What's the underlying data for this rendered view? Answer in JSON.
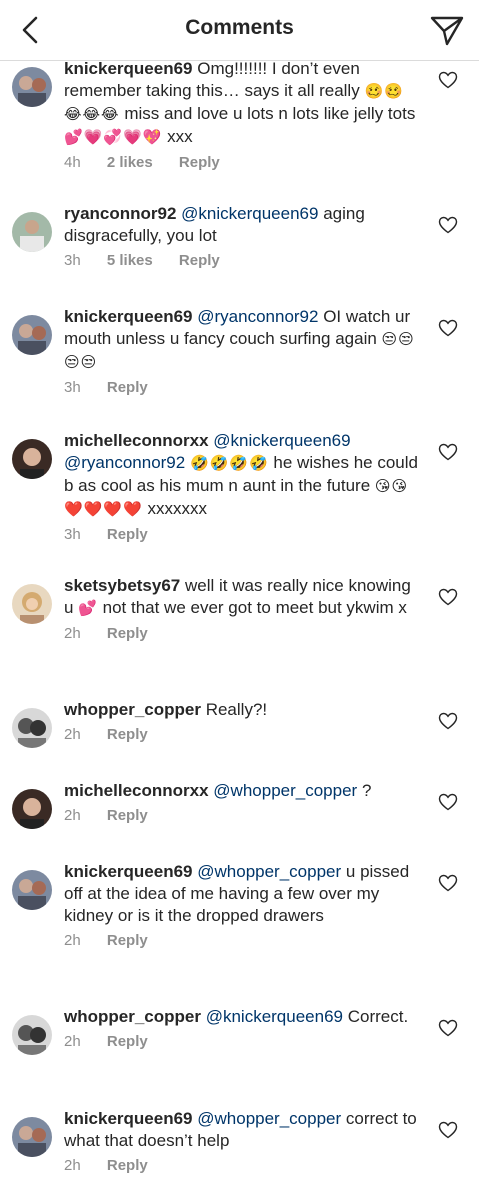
{
  "header": {
    "title": "Comments"
  },
  "comments": [
    {
      "username": "knickerqueen69",
      "mention": "",
      "text": "Omg!!!!!!! I don’t even remember taking this… says it all really",
      "emoji": "🥴🥴😂😂😂",
      "text2": "miss and love u lots n lots like jelly tots",
      "emoji2": "💕💗💞💗💖",
      "text3": "xxx",
      "time": "4h",
      "likes": "2 likes",
      "reply": "Reply"
    },
    {
      "username": "ryanconnor92",
      "mention": "@knickerqueen69",
      "text": "aging disgracefully, you lot",
      "emoji": "",
      "text2": "",
      "emoji2": "",
      "text3": "",
      "time": "3h",
      "likes": "5 likes",
      "reply": "Reply"
    },
    {
      "username": "knickerqueen69",
      "mention": "@ryanconnor92",
      "text": "OI watch ur mouth unless u fancy couch surfing again",
      "emoji": "😒😒😒😒",
      "text2": "",
      "emoji2": "",
      "text3": "",
      "time": "3h",
      "likes": "",
      "reply": "Reply"
    },
    {
      "username": "michelleconnorxx",
      "mention": "@knickerqueen69 @ryanconnor92",
      "text": "",
      "emoji": "🤣🤣🤣🤣",
      "text2": "he wishes he could b as cool as his mum n aunt in the future",
      "emoji2": "😘😘❤️❤️❤️❤️",
      "text3": "xxxxxxx",
      "time": "3h",
      "likes": "",
      "reply": "Reply"
    },
    {
      "username": "sketsybetsy67",
      "mention": "",
      "text": "well it was really nice knowing u",
      "emoji": "💕",
      "text2": "not that we ever got to meet but ykwim x",
      "emoji2": "",
      "text3": "",
      "time": "2h",
      "likes": "",
      "reply": "Reply"
    },
    {
      "username": "whopper_copper",
      "mention": "",
      "text": "Really?!",
      "emoji": "",
      "text2": "",
      "emoji2": "",
      "text3": "",
      "time": "2h",
      "likes": "",
      "reply": "Reply"
    },
    {
      "username": "michelleconnorxx",
      "mention": "@whopper_copper",
      "text": "?",
      "emoji": "",
      "text2": "",
      "emoji2": "",
      "text3": "",
      "time": "2h",
      "likes": "",
      "reply": "Reply"
    },
    {
      "username": "knickerqueen69",
      "mention": "@whopper_copper",
      "text": "u pissed off at the idea of me having a few over my kidney or is it the dropped drawers",
      "emoji": "",
      "text2": "",
      "emoji2": "",
      "text3": "",
      "time": "2h",
      "likes": "",
      "reply": "Reply"
    },
    {
      "username": "whopper_copper",
      "mention": "@knickerqueen69",
      "text": "Correct.",
      "emoji": "",
      "text2": "",
      "emoji2": "",
      "text3": "",
      "time": "2h",
      "likes": "",
      "reply": "Reply"
    },
    {
      "username": "knickerqueen69",
      "mention": "@whopper_copper",
      "text": "correct to what that doesn’t help",
      "emoji": "",
      "text2": "",
      "emoji2": "",
      "text3": "",
      "time": "2h",
      "likes": "",
      "reply": "Reply"
    }
  ],
  "colors": {
    "text": "#262626",
    "meta": "#8e8e8e",
    "mention": "#003569",
    "divider": "#dbdbdb"
  },
  "icons": {
    "back": "chevron-left-icon",
    "send": "paper-plane-icon",
    "like": "heart-outline-icon"
  }
}
